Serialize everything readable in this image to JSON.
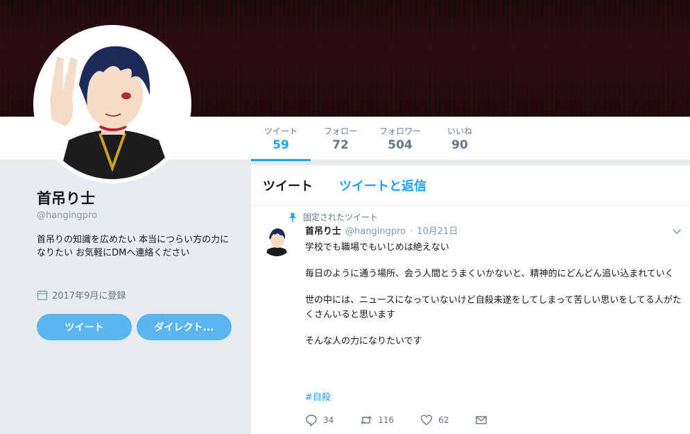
{
  "profile": {
    "name": "首吊り士",
    "handle": "@hangingpro",
    "bio": "首吊りの知識を広めたい 本当につらい方の力になりたい お気軽にDMへ連絡ください",
    "joined": "2017年9月に登録",
    "tweet_button": "ツイート",
    "dm_button": "ダイレクト..."
  },
  "stats": [
    {
      "label": "ツイート",
      "value": "59"
    },
    {
      "label": "フォロー",
      "value": "72"
    },
    {
      "label": "フォロワー",
      "value": "504"
    },
    {
      "label": "いいね",
      "value": "90"
    }
  ],
  "tabs": {
    "tweets": "ツイート",
    "tweets_replies": "ツイートと返信"
  },
  "tweet": {
    "pinned_label": "固定されたツイート",
    "name": "首吊り士",
    "handle": "@hangingpro",
    "separator": "·",
    "date": "10月21日",
    "paragraphs": [
      "学校でも職場でもいじめは絶えない",
      "毎日のように通う場所、会う人間とうまくいかないと、精神的にどんどん追い込まれていく",
      "世の中には、ニュースになっていないけど自殺未遂をしてしまって苦しい思いをしてる人がたくさんいると思います",
      "そんな人の力になりたいです"
    ],
    "hashtag": "#自殺",
    "reply_count": "34",
    "retweet_count": "116",
    "like_count": "62"
  },
  "icons": {
    "calendar": "calendar-icon",
    "pin": "pin-icon",
    "reply": "reply-icon",
    "retweet": "retweet-icon",
    "like": "heart-icon",
    "dm": "mail-icon",
    "caret": "chevron-down-icon"
  },
  "colors": {
    "accent": "#1da1f2",
    "button": "#5bb5ee",
    "banner": "#1e0a0d"
  }
}
